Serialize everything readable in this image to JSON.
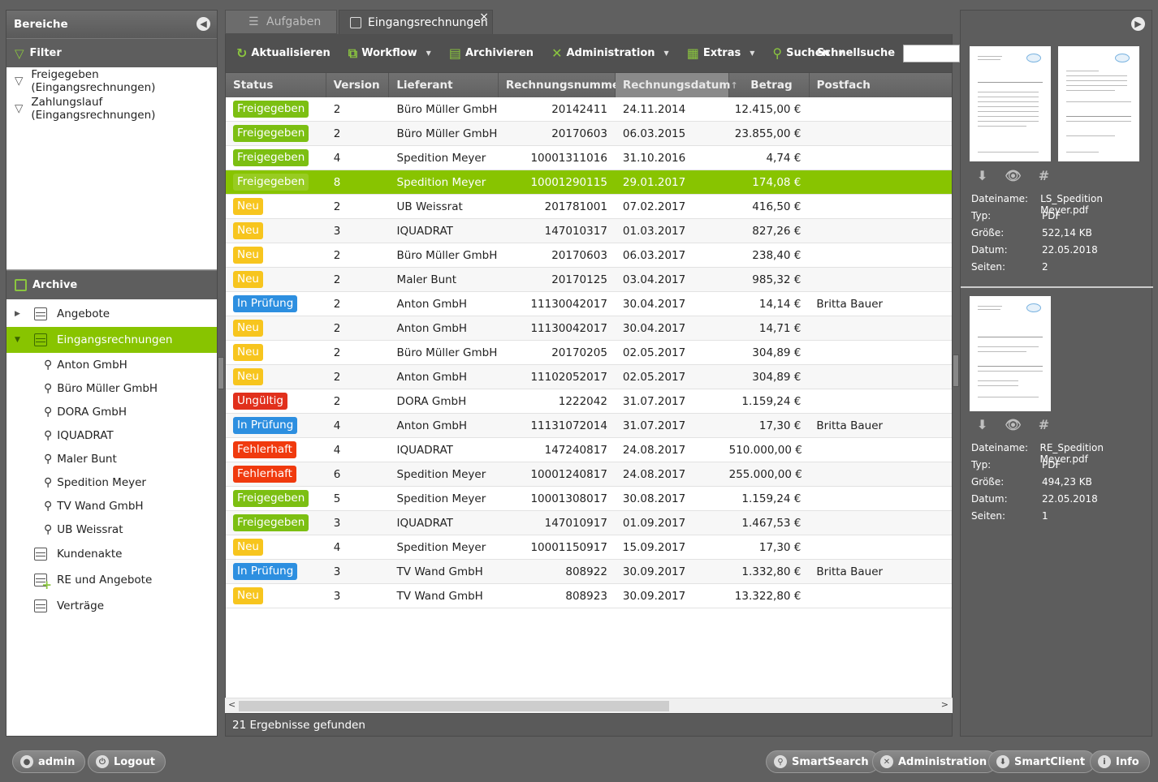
{
  "sidebar": {
    "title": "Bereiche",
    "filter_title": "Filter",
    "filters": [
      "Freigegeben (Eingangsrechnungen)",
      "Zahlungslauf (Eingangsrechnungen)"
    ],
    "archive_title": "Archive",
    "archives": [
      {
        "label": "Angebote"
      },
      {
        "label": "Eingangsrechnungen"
      }
    ],
    "subitems": [
      "Anton GmbH",
      "Büro Müller GmbH",
      "DORA GmbH",
      "IQUADRAT",
      "Maler Bunt",
      "Spedition Meyer",
      "TV Wand GmbH",
      "UB Weissrat"
    ],
    "archives_after": [
      "Kundenakte",
      "RE und Angebote",
      "Verträge"
    ]
  },
  "tabs": [
    {
      "label": "Aufgaben"
    },
    {
      "label": "Eingangsrechnungen",
      "close": "×"
    }
  ],
  "toolbar": {
    "refresh": "Aktualisieren",
    "workflow": "Workflow",
    "archive": "Archivieren",
    "admin": "Administration",
    "extras": "Extras",
    "search": "Suchen",
    "quick_label": "Schnellsuche"
  },
  "columns": [
    "Status",
    "Version",
    "Lieferant",
    "Rechnungsnummer",
    "Rechnungsdatum",
    "Betrag",
    "Postfach"
  ],
  "status_colors": {
    "Freigegeben": "#7cbf12",
    "Neu": "#f7c51e",
    "In Prüfung": "#2d8fe0",
    "Ungültig": "#e1301c",
    "Fehlerhaft": "#f03a0e"
  },
  "rows": [
    {
      "status": "Freigegeben",
      "version": "2",
      "supplier": "Büro Müller GmbH",
      "number": "20142411",
      "date": "24.11.2014",
      "amount": "12.415,00 €",
      "inbox": ""
    },
    {
      "status": "Freigegeben",
      "version": "2",
      "supplier": "Büro Müller GmbH",
      "number": "20170603",
      "date": "06.03.2015",
      "amount": "23.855,00 €",
      "inbox": ""
    },
    {
      "status": "Freigegeben",
      "version": "4",
      "supplier": "Spedition Meyer",
      "number": "10001311016",
      "date": "31.10.2016",
      "amount": "4,74 €",
      "inbox": ""
    },
    {
      "status": "Freigegeben",
      "version": "8",
      "supplier": "Spedition Meyer",
      "number": "10001290115",
      "date": "29.01.2017",
      "amount": "174,08 €",
      "inbox": "",
      "selected": true
    },
    {
      "status": "Neu",
      "version": "2",
      "supplier": "UB Weissrat",
      "number": "201781001",
      "date": "07.02.2017",
      "amount": "416,50 €",
      "inbox": ""
    },
    {
      "status": "Neu",
      "version": "3",
      "supplier": "IQUADRAT",
      "number": "147010317",
      "date": "01.03.2017",
      "amount": "827,26 €",
      "inbox": ""
    },
    {
      "status": "Neu",
      "version": "2",
      "supplier": "Büro Müller GmbH",
      "number": "20170603",
      "date": "06.03.2017",
      "amount": "238,40 €",
      "inbox": ""
    },
    {
      "status": "Neu",
      "version": "2",
      "supplier": "Maler Bunt",
      "number": "20170125",
      "date": "03.04.2017",
      "amount": "985,32 €",
      "inbox": ""
    },
    {
      "status": "In Prüfung",
      "version": "2",
      "supplier": "Anton GmbH",
      "number": "11130042017",
      "date": "30.04.2017",
      "amount": "14,14 €",
      "inbox": "Britta Bauer"
    },
    {
      "status": "Neu",
      "version": "2",
      "supplier": "Anton GmbH",
      "number": "11130042017",
      "date": "30.04.2017",
      "amount": "14,71 €",
      "inbox": ""
    },
    {
      "status": "Neu",
      "version": "2",
      "supplier": "Büro Müller GmbH",
      "number": "20170205",
      "date": "02.05.2017",
      "amount": "304,89 €",
      "inbox": ""
    },
    {
      "status": "Neu",
      "version": "2",
      "supplier": "Anton GmbH",
      "number": "11102052017",
      "date": "02.05.2017",
      "amount": "304,89 €",
      "inbox": ""
    },
    {
      "status": "Ungültig",
      "version": "2",
      "supplier": "DORA GmbH",
      "number": "1222042",
      "date": "31.07.2017",
      "amount": "1.159,24 €",
      "inbox": ""
    },
    {
      "status": "In Prüfung",
      "version": "4",
      "supplier": "Anton GmbH",
      "number": "11131072014",
      "date": "31.07.2017",
      "amount": "17,30 €",
      "inbox": "Britta Bauer"
    },
    {
      "status": "Fehlerhaft",
      "version": "4",
      "supplier": "IQUADRAT",
      "number": "147240817",
      "date": "24.08.2017",
      "amount": "510.000,00 €",
      "inbox": ""
    },
    {
      "status": "Fehlerhaft",
      "version": "6",
      "supplier": "Spedition Meyer",
      "number": "10001240817",
      "date": "24.08.2017",
      "amount": "255.000,00 €",
      "inbox": ""
    },
    {
      "status": "Freigegeben",
      "version": "5",
      "supplier": "Spedition Meyer",
      "number": "10001308017",
      "date": "30.08.2017",
      "amount": "1.159,24 €",
      "inbox": ""
    },
    {
      "status": "Freigegeben",
      "version": "3",
      "supplier": "IQUADRAT",
      "number": "147010917",
      "date": "01.09.2017",
      "amount": "1.467,53 €",
      "inbox": ""
    },
    {
      "status": "Neu",
      "version": "4",
      "supplier": "Spedition Meyer",
      "number": "10001150917",
      "date": "15.09.2017",
      "amount": "17,30 €",
      "inbox": ""
    },
    {
      "status": "In Prüfung",
      "version": "3",
      "supplier": "TV Wand GmbH",
      "number": "808922",
      "date": "30.09.2017",
      "amount": "1.332,80 €",
      "inbox": "Britta Bauer"
    },
    {
      "status": "Neu",
      "version": "3",
      "supplier": "TV Wand GmbH",
      "number": "808923",
      "date": "30.09.2017",
      "amount": "13.322,80 €",
      "inbox": ""
    }
  ],
  "status_bar": "21 Ergebnisse gefunden",
  "preview": {
    "labels": {
      "name": "Dateiname:",
      "type": "Typ:",
      "size": "Größe:",
      "date": "Datum:",
      "pages": "Seiten:"
    },
    "files": [
      {
        "name": "LS_Spedition Meyer.pdf",
        "type": "PDF",
        "size": "522,14 KB",
        "date": "22.05.2018",
        "pages": "2"
      },
      {
        "name": "RE_Spedition Meyer.pdf",
        "type": "PDF",
        "size": "494,23 KB",
        "date": "22.05.2018",
        "pages": "1"
      }
    ]
  },
  "footer": {
    "user": "admin",
    "logout": "Logout",
    "smartsearch": "SmartSearch",
    "administration": "Administration",
    "smartclient": "SmartClient",
    "info": "Info"
  }
}
